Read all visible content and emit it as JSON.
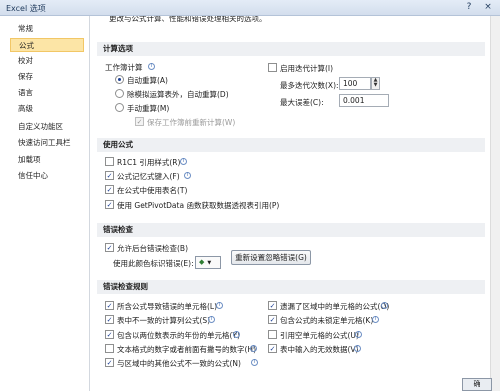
{
  "window": {
    "title": "Excel 选项",
    "help_icon": "?",
    "close_icon": "×"
  },
  "sidebar": {
    "items": [
      {
        "label": "常规"
      },
      {
        "label": "公式",
        "active": true
      },
      {
        "label": "校对"
      },
      {
        "label": "保存"
      },
      {
        "label": "语言"
      },
      {
        "label": "高级"
      },
      {
        "label": "自定义功能区"
      },
      {
        "label": "快速访问工具栏"
      },
      {
        "label": "加载项"
      },
      {
        "label": "信任中心"
      }
    ]
  },
  "top_text": "更改与公式计算、性能和错误处理相关的选项。",
  "calc": {
    "section_title": "计算选项",
    "workbook_calc_label": "工作簿计算",
    "auto_label": "自动重算(A)",
    "auto_except_label": "除模拟运算表外，自动重算(D)",
    "manual_label": "手动重算(M)",
    "recalc_before_save_label": "保存工作簿前重新计算(W)",
    "iterative_label": "启用迭代计算(I)",
    "max_iterations_label": "最多迭代次数(X):",
    "max_iterations_value": "100",
    "max_change_label": "最大误差(C):",
    "max_change_value": "0.001"
  },
  "formulas": {
    "section_title": "使用公式",
    "r1c1_label": "R1C1 引用样式(R)",
    "autocomplete_label": "公式记忆式键入(F)",
    "table_names_label": "在公式中使用表名(T)",
    "getpivot_label": "使用 GetPivotData 函数获取数据透视表引用(P)"
  },
  "error_checking": {
    "section_title": "错误检查",
    "background_label": "允许后台错误检查(B)",
    "color_label": "使用此颜色标识错误(E):",
    "reset_button_label": "重新设置忽略错误(G)"
  },
  "rules": {
    "section_title": "错误检查规则",
    "left": [
      {
        "label": "所含公式导致错误的单元格(L)",
        "checked": true
      },
      {
        "label": "表中不一致的计算列公式(S)",
        "checked": true
      },
      {
        "label": "包含以两位数表示的年份的单元格(Y)",
        "checked": true
      },
      {
        "label": "文本格式的数字或者前面有撇号的数字(H)",
        "checked": false
      },
      {
        "label": "与区域中的其他公式不一致的公式(N)",
        "checked": true
      }
    ],
    "right": [
      {
        "label": "遗漏了区域中的单元格的公式(O)",
        "checked": true
      },
      {
        "label": "包含公式的未锁定单元格(K)",
        "checked": true
      },
      {
        "label": "引用空单元格的公式(U)",
        "checked": false
      },
      {
        "label": "表中输入的无效数据(V)",
        "checked": true
      }
    ]
  },
  "footer": {
    "partial_button_label": "确"
  }
}
